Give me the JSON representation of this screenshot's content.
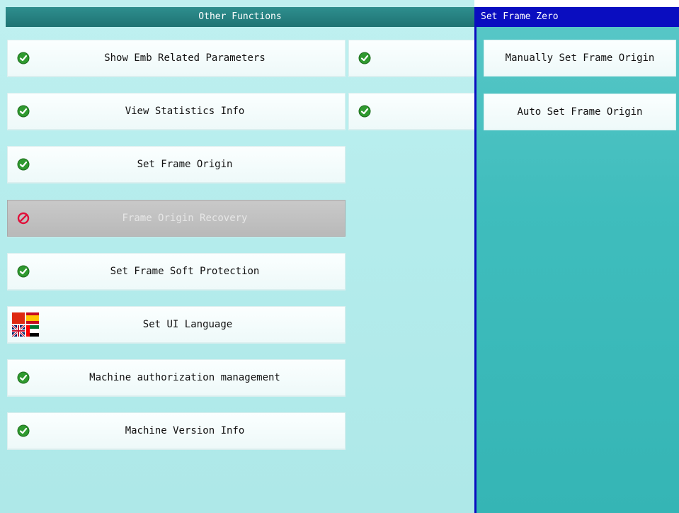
{
  "left_panel": {
    "title": "Other Functions",
    "buttons": [
      {
        "label": "Show Emb Related Parameters",
        "icon": "check-icon"
      },
      {
        "label": "View Statistics Info",
        "icon": "check-icon"
      },
      {
        "label": "Set Frame Origin",
        "icon": "check-icon"
      },
      {
        "label": "Frame Origin Recovery",
        "icon": "prohibited-icon",
        "state": "disabled"
      },
      {
        "label": "Set Frame Soft Protection",
        "icon": "check-icon"
      },
      {
        "label": "Set UI Language",
        "icon": "language-flags-icon"
      },
      {
        "label": "Machine authorization management",
        "icon": "check-icon"
      },
      {
        "label": "Machine Version Info",
        "icon": "check-icon"
      }
    ],
    "second_column": [
      {
        "label": "",
        "icon": "check-icon"
      },
      {
        "label": "",
        "icon": "check-icon"
      }
    ]
  },
  "right_panel": {
    "title": "Set Frame Zero",
    "buttons": [
      {
        "label": "Manually Set Frame Origin"
      },
      {
        "label": "Auto Set Frame Origin"
      }
    ]
  },
  "colors": {
    "header_teal": "#2e8f8e",
    "right_header_blue": "#0a0dc0",
    "right_panel_bg": "#3fbdbd",
    "check_green": "#2f9a2f",
    "prohibited_red": "#e0103a"
  }
}
